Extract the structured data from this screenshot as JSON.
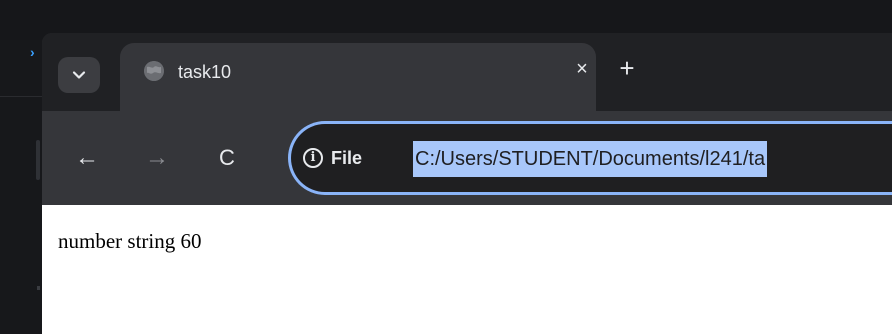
{
  "tab": {
    "title": "task10",
    "close_label": "×"
  },
  "new_tab_label": "+",
  "nav": {
    "back_label": "←",
    "forward_label": "→",
    "reload_label": "C"
  },
  "omnibox": {
    "security_label": "File",
    "url": "C:/Users/STUDENT/Documents/l241/ta"
  },
  "page": {
    "body_text": "number string 60"
  },
  "icons": {
    "tab_search": "chevron-down-icon",
    "favicon": "globe-icon",
    "security": "info-icon"
  },
  "colors": {
    "accent": "#8ab4f8",
    "selection": "#a8c7fa"
  }
}
